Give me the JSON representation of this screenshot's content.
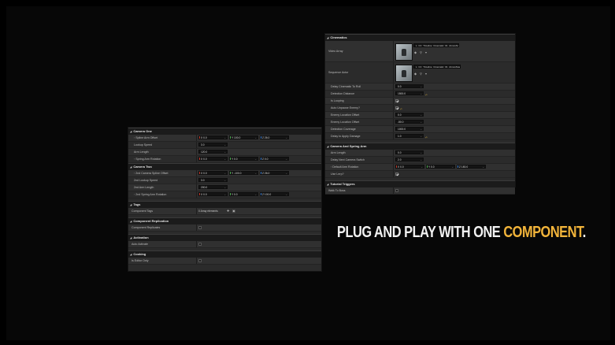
{
  "colors": {
    "accent": "#f2b43a",
    "panel_bg": "#2b2b2b",
    "header_bg": "#1b1b1b",
    "input_bg": "#141414"
  },
  "headline": {
    "part1": "PLUG AND PLAY WITH ONE ",
    "highlight": "COMPONENT",
    "part3": "."
  },
  "left_panel": {
    "camera_one": {
      "title": "Camera One",
      "rows": [
        {
          "label": "Spline Arm Offset",
          "x": "X 0.0",
          "y": "Y 100.0",
          "z": "Z 26.0"
        },
        {
          "label": "Lookup Speed",
          "value": "3.0"
        },
        {
          "label": "Arm Length",
          "value": "120.0"
        },
        {
          "label": "Spring Arm Rotation",
          "x": "X 0.0",
          "y": "Y 0.0",
          "z": "Z 0.0"
        }
      ]
    },
    "camera_two": {
      "title": "Camera Two",
      "rows": [
        {
          "label": "2nd Camera Spline Offset",
          "x": "X 0.0",
          "y": "Y -100.0",
          "z": "Z 26.0"
        },
        {
          "label": "2nd Lookup Speed",
          "value": "3.0"
        },
        {
          "label": "2nd Arm Length",
          "value": "200.0"
        },
        {
          "label": "2nd Spring Arm Rotation",
          "x": "X 0.0",
          "y": "Y 0.0",
          "z": "Z 100.0"
        }
      ]
    },
    "tags": {
      "title": "Tags",
      "row_label": "Component Tags",
      "row_value": "0 Array elements"
    },
    "component_replication": {
      "title": "Component Replication",
      "row_label": "Component Replicates"
    },
    "activation": {
      "title": "Activation",
      "row_label": "Auto Activate"
    },
    "cooking": {
      "title": "Cooking",
      "row_label": "Is Editor Only"
    }
  },
  "right_panel": {
    "cinematics": {
      "title": "Cinematics",
      "video_array_label": "Video Array",
      "video_array_asset": "L_CC_Timeline_Cinematic_01_AtmosSpace",
      "sequence_label": "Sequence Actor",
      "sequence_asset": "L_CC_Timeline_Cinematic_01_AtmosSpace_d",
      "rows": [
        {
          "label": "Delay Cinematic To Roll",
          "value": "0.0"
        },
        {
          "label": "Detection Distance",
          "value": "1500.0",
          "reset": true
        },
        {
          "label": "Is Looping",
          "check": true
        },
        {
          "label": "Auto Unpause Enemy?",
          "check": true,
          "reset": true
        },
        {
          "label": "Enemy Location Offset",
          "value": "0.0"
        },
        {
          "label": "Enemy Location Offset",
          "value": "-50.0"
        },
        {
          "label": "Detection Coverage",
          "value": "1000.0"
        },
        {
          "label": "Delay to Apply Damage",
          "value": "1.0",
          "reset": true
        }
      ]
    },
    "camera_spring_arm": {
      "title": "Camera And Spring Arm",
      "rows": [
        {
          "label": "Arm Length",
          "value": "0.0"
        },
        {
          "label": "Delay Next Camera Switch",
          "value": "2.0"
        },
        {
          "label": "Default Arm Rotation",
          "x": "X 0.0",
          "y": "Y 0.0",
          "z": "Z 180.0"
        },
        {
          "label": "Use Lerp?",
          "check": true
        }
      ]
    },
    "tutorial": {
      "title": "Tutorial Triggers",
      "row_label": "Walk To Boss"
    }
  },
  "icons": [
    "collapse-arrow-icon",
    "reset-arrow-icon",
    "dropdown-icon",
    "browse-icon",
    "add-icon",
    "trash-icon"
  ]
}
